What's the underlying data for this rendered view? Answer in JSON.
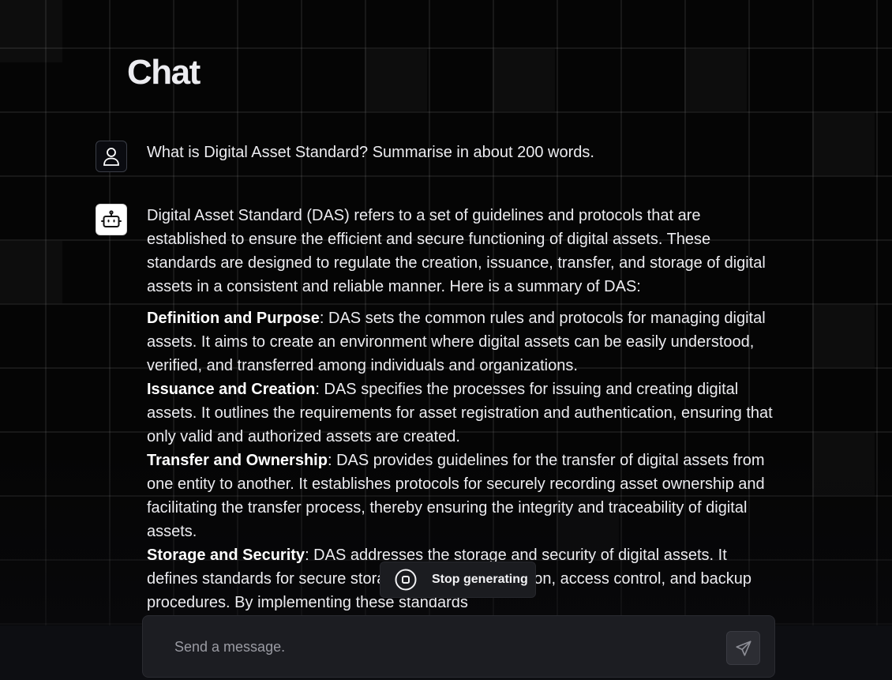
{
  "header": {
    "title": "Chat"
  },
  "conversation": {
    "user_message": "What is Digital Asset Standard? Summarise in about 200 words.",
    "assistant_intro": "Digital Asset Standard (DAS) refers to a set of guidelines and protocols that are established to ensure the efficient and secure functioning of digital assets. These standards are designed to regulate the creation, issuance, transfer, and storage of digital assets in a consistent and reliable manner. Here is a summary of DAS:",
    "assistant_points": [
      {
        "heading": "Definition and Purpose",
        "text": ": DAS sets the common rules and protocols for managing digital assets. It aims to create an environment where digital assets can be easily understood, verified, and transferred among individuals and organizations."
      },
      {
        "heading": "Issuance and Creation",
        "text": ": DAS specifies the processes for issuing and creating digital assets. It outlines the requirements for asset registration and authentication, ensuring that only valid and authorized assets are created."
      },
      {
        "heading": "Transfer and Ownership",
        "text": ": DAS provides guidelines for the transfer of digital assets from one entity to another. It establishes protocols for securely recording asset ownership and facilitating the transfer process, thereby ensuring the integrity and traceability of digital assets."
      },
      {
        "heading": "Storage and Security",
        "text": ": DAS addresses the storage and security of digital assets. It defines standards for secure storage, including encryption, access control, and backup procedures. By implementing these standards"
      }
    ]
  },
  "stop_button": {
    "label": "Stop generating",
    "icon": "stop-circle-icon"
  },
  "composer": {
    "placeholder": "Send a message.",
    "value": "",
    "send_icon": "send-icon"
  },
  "icons": {
    "user_avatar": "user-icon",
    "assistant_avatar": "robot-icon"
  },
  "colors": {
    "background": "#000000",
    "text": "#ececf0",
    "composer_bg": "#1c1d22",
    "stop_button_bg": "#1b1c20"
  }
}
